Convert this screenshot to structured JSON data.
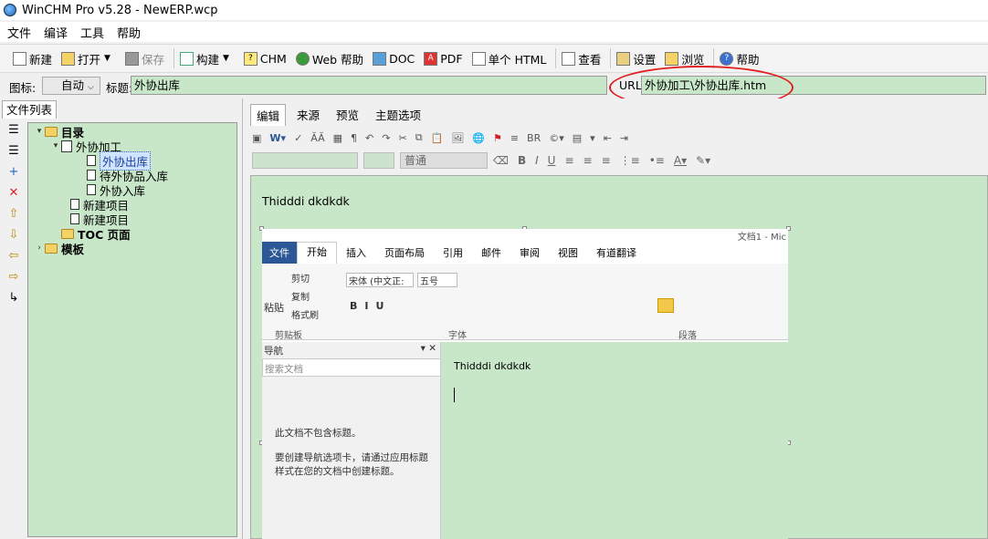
{
  "window": {
    "title": "WinCHM Pro v5.28 - NewERP.wcp"
  },
  "menu": [
    "文件",
    "编译",
    "工具",
    "帮助"
  ],
  "toolbar": {
    "new": "新建",
    "open": "打开",
    "save": "保存",
    "build": "构建",
    "chm": "CHM",
    "web_help": "Web 帮助",
    "doc": "DOC",
    "pdf": "PDF",
    "single_html": "单个 HTML",
    "view": "查看",
    "settings": "设置",
    "browse": "浏览",
    "help": "帮助"
  },
  "fields": {
    "icon_label": "图标:",
    "icon_value": "自动",
    "title_label": "标题:",
    "title_value": "外协出库",
    "url_label": "URL:",
    "url_value": "外协加工\\外协出库.htm"
  },
  "left_panel": {
    "tab": "文件列表",
    "tree": {
      "root": "目录",
      "group": "外协加工",
      "items": [
        "外协出库",
        "待外协品入库",
        "外协入库"
      ],
      "new_items": [
        "新建项目",
        "新建项目"
      ],
      "toc": "TOC 页面",
      "template": "模板"
    }
  },
  "editor": {
    "tabs": [
      "编辑",
      "来源",
      "预览",
      "主题选项"
    ],
    "style_combo": "普通",
    "content_text": "Thidddi dkdkdk"
  },
  "word_screenshot": {
    "tabs": [
      "文件",
      "开始",
      "插入",
      "页面布局",
      "引用",
      "邮件",
      "审阅",
      "视图",
      "有道翻译"
    ],
    "window_title_fragment": "文档1 - Mic",
    "clipboard": {
      "paste": "粘贴",
      "cut": "剪切",
      "copy": "复制",
      "format_painter": "格式刷",
      "label": "剪贴板"
    },
    "font": {
      "name": "宋体 (中文正:",
      "size": "五号",
      "label": "字体"
    },
    "paragraph_label": "段落",
    "nav": {
      "title": "导航",
      "search_placeholder": "搜索文档",
      "no_headings": "此文档不包含标题。",
      "hint": "要创建导航选项卡，请通过应用标题样式在您的文档中创建标题。"
    },
    "page_text": "Thidddi dkdkdk"
  },
  "colors": {
    "green_bg": "#c8e6c8",
    "annotation_red": "#e02020"
  }
}
